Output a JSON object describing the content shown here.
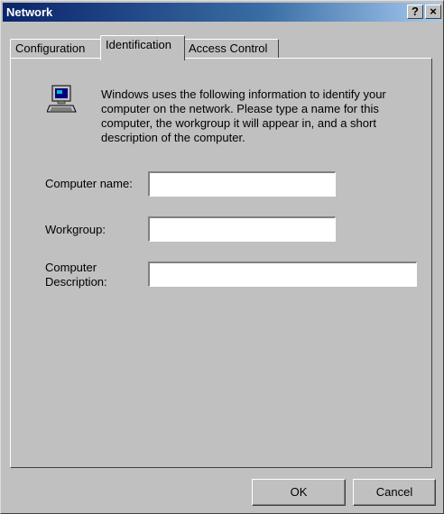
{
  "window": {
    "title": "Network",
    "help_label": "?",
    "close_label": "×"
  },
  "tabs": [
    {
      "label": "Configuration",
      "selected": false
    },
    {
      "label": "Identification",
      "selected": true
    },
    {
      "label": "Access Control",
      "selected": false
    }
  ],
  "identification": {
    "icon": "computer-icon",
    "description": "Windows uses the following information to identify your computer on the network.  Please type a name for this computer, the workgroup it will appear in, and a short description of the computer.",
    "computer_name_label": "Computer name:",
    "computer_name_value": "",
    "workgroup_label": "Workgroup:",
    "workgroup_value": "",
    "computer_description_label": "Computer Description:",
    "computer_description_value": ""
  },
  "buttons": {
    "ok_label": "OK",
    "cancel_label": "Cancel"
  }
}
